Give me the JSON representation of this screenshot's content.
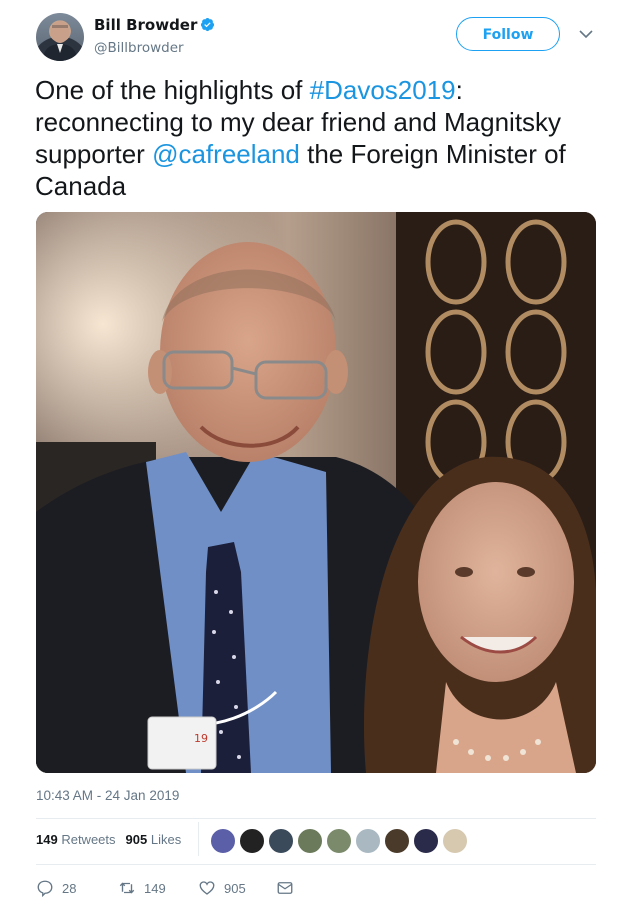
{
  "author": {
    "name": "Bill Browder",
    "handle": "@Billbrowder",
    "verified": true
  },
  "follow_label": "Follow",
  "tweet": {
    "segments": [
      {
        "text": "One of the highlights of ",
        "link": false
      },
      {
        "text": "#Davos2019",
        "link": true
      },
      {
        "text": ": reconnecting to my dear friend and Magnitsky supporter ",
        "link": false
      },
      {
        "text": "@cafreeland",
        "link": true
      },
      {
        "text": " the Foreign Minister of Canada",
        "link": false
      }
    ]
  },
  "photo_badge_text": "19",
  "timestamp": "10:43 AM - 24 Jan 2019",
  "stats": {
    "retweets_count": "149",
    "retweets_label": "Retweets",
    "likes_count": "905",
    "likes_label": "Likes"
  },
  "liker_avatar_colors": [
    "#5a5fa8",
    "#222222",
    "#3a4a5a",
    "#6b7a5a",
    "#7a8a6a",
    "#aab8c2",
    "#4a3a2a",
    "#2a2a4a",
    "#d6c9b0"
  ],
  "actions": {
    "reply_count": "28",
    "retweet_count": "149",
    "like_count": "905"
  },
  "colors": {
    "accent": "#1da1f2",
    "link": "#1b95e0",
    "secondary_text": "#657786",
    "divider": "#e6ecf0"
  },
  "icons": [
    "verified-badge-icon",
    "chevron-down-icon",
    "reply-icon",
    "retweet-icon",
    "like-icon",
    "direct-message-icon"
  ]
}
